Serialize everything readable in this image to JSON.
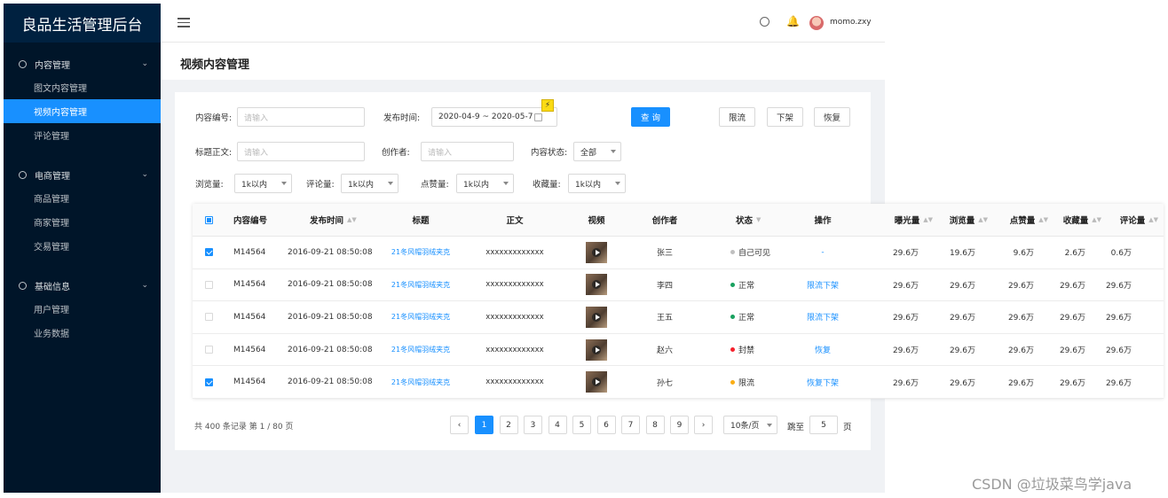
{
  "sidebar": {
    "logo": "良品生活管理后台",
    "groups": [
      {
        "title": "内容管理",
        "items": [
          "图文内容管理",
          "视频内容管理",
          "评论管理"
        ]
      },
      {
        "title": "电商管理",
        "items": [
          "商品管理",
          "商家管理",
          "交易管理"
        ]
      },
      {
        "title": "基础信息",
        "items": [
          "用户管理",
          "业务数据"
        ]
      }
    ],
    "active_item": "视频内容管理"
  },
  "header": {
    "username": "momo.zxy"
  },
  "page_title": "视频内容管理",
  "filters": {
    "content_id_label": "内容编号:",
    "content_id_placeholder": "请输入",
    "publish_time_label": "发布时间:",
    "publish_time_value": "2020-04-9 ~ 2020-05-7",
    "title_text_label": "标题正文:",
    "title_text_placeholder": "请输入",
    "author_label": "创作者:",
    "author_placeholder": "请输入",
    "status_label": "内容状态:",
    "status_value": "全部",
    "views_label": "浏览量:",
    "views_value": "1k以内",
    "comments_label": "评论量:",
    "comments_value": "1k以内",
    "likes_label": "点赞量:",
    "likes_value": "1k以内",
    "favorites_label": "收藏量:",
    "favorites_value": "1k以内"
  },
  "actions": {
    "query": "查 询",
    "limit": "限流",
    "offline": "下架",
    "restore": "恢复"
  },
  "table": {
    "columns": [
      "内容编号",
      "发布时间",
      "标题",
      "正文",
      "视频",
      "创作者",
      "状态",
      "操作",
      "曝光量",
      "浏览量",
      "点赞量",
      "收藏量",
      "评论量"
    ],
    "rows": [
      {
        "checked": true,
        "id": "M14564",
        "time": "2016-09-21  08:50:08",
        "title": "21冬风帽羽绒夹克",
        "body": "xxxxxxxxxxxxx",
        "author": "张三",
        "status": "自己可见",
        "status_color": "#bfbfbf",
        "op": "-",
        "exposure": "29.6万",
        "views": "19.6万",
        "likes": "9.6万",
        "favorites": "2.6万",
        "comments": "0.6万"
      },
      {
        "checked": false,
        "id": "M14564",
        "time": "2016-09-21  08:50:08",
        "title": "21冬风帽羽绒夹克",
        "body": "xxxxxxxxxxxxx",
        "author": "李四",
        "status": "正常",
        "status_color": "#19a15f",
        "op": "限流 下架",
        "exposure": "29.6万",
        "views": "29.6万",
        "likes": "29.6万",
        "favorites": "29.6万",
        "comments": "29.6万"
      },
      {
        "checked": false,
        "id": "M14564",
        "time": "2016-09-21  08:50:08",
        "title": "21冬风帽羽绒夹克",
        "body": "xxxxxxxxxxxxx",
        "author": "王五",
        "status": "正常",
        "status_color": "#19a15f",
        "op": "限流 下架",
        "exposure": "29.6万",
        "views": "29.6万",
        "likes": "29.6万",
        "favorites": "29.6万",
        "comments": "29.6万"
      },
      {
        "checked": false,
        "id": "M14564",
        "time": "2016-09-21  08:50:08",
        "title": "21冬风帽羽绒夹克",
        "body": "xxxxxxxxxxxxx",
        "author": "赵六",
        "status": "封禁",
        "status_color": "#f5222d",
        "op": "恢复",
        "exposure": "29.6万",
        "views": "29.6万",
        "likes": "29.6万",
        "favorites": "29.6万",
        "comments": "29.6万"
      },
      {
        "checked": true,
        "id": "M14564",
        "time": "2016-09-21  08:50:08",
        "title": "21冬风帽羽绒夹克",
        "body": "xxxxxxxxxxxxx",
        "author": "孙七",
        "status": "限流",
        "status_color": "#faad14",
        "op": "恢复 下架",
        "exposure": "29.6万",
        "views": "29.6万",
        "likes": "29.6万",
        "favorites": "29.6万",
        "comments": "29.6万"
      }
    ]
  },
  "pagination": {
    "total_text": "共 400 条记录 第 1 / 80 页",
    "pages": [
      "1",
      "2",
      "3",
      "4",
      "5",
      "6",
      "7",
      "8",
      "9"
    ],
    "current": "1",
    "page_size": "10条/页",
    "jump_label": "跳至",
    "jump_value": "5",
    "jump_suffix": "页"
  },
  "watermark": "CSDN @垃圾菜鸟学java"
}
